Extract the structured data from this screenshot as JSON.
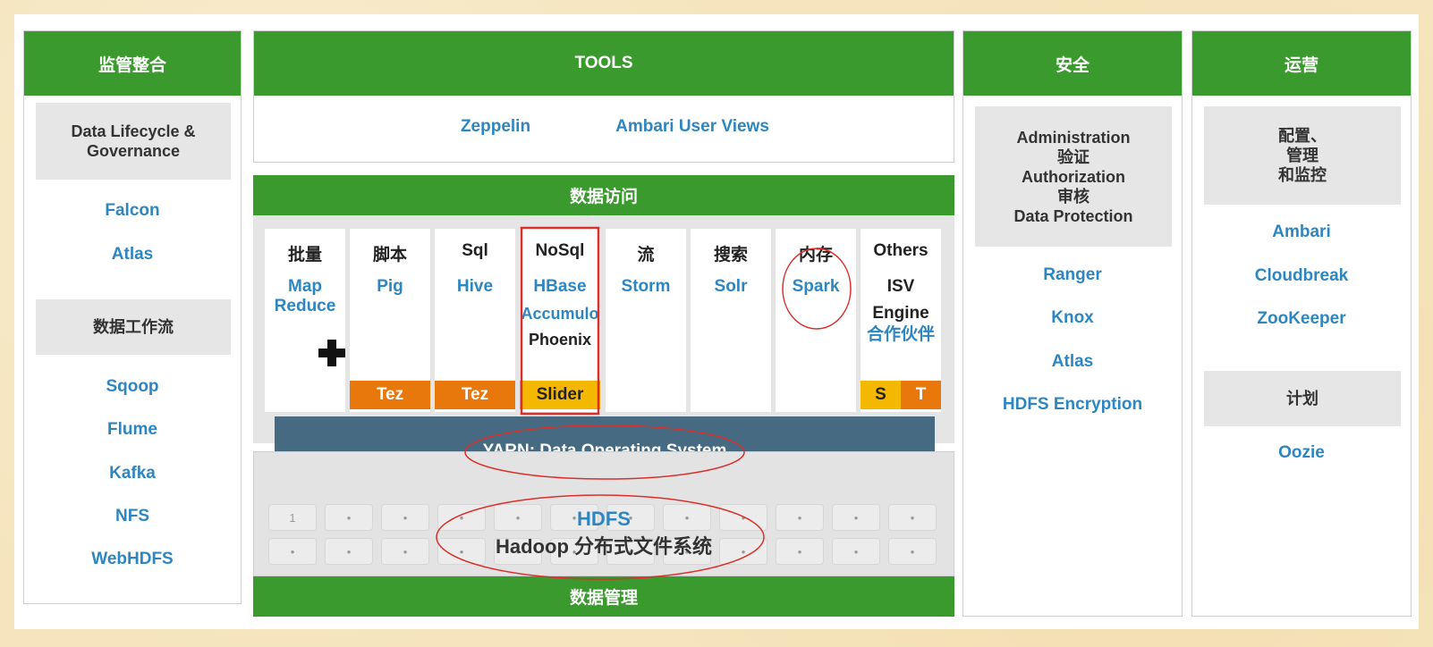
{
  "governance": {
    "header": "监管整合",
    "box1": [
      "Data Lifecycle &",
      "Governance"
    ],
    "links1": [
      "Falcon",
      "Atlas"
    ],
    "box2": "数据工作流",
    "links2": [
      "Sqoop",
      "Flume",
      "Kafka",
      "NFS",
      "WebHDFS"
    ]
  },
  "tools": {
    "header": "TOOLS",
    "items": [
      "Zeppelin",
      "Ambari User Views"
    ]
  },
  "data_access": {
    "header": "数据访问",
    "cards": [
      {
        "title": "批量",
        "lines": [
          "Map",
          "Reduce"
        ]
      },
      {
        "title": "脚本",
        "lines": [
          "Pig"
        ],
        "engine": "Tez"
      },
      {
        "title": "Sql",
        "lines": [
          "Hive"
        ],
        "engine": "Tez"
      },
      {
        "title": "NoSql",
        "lines": [
          "HBase",
          "Accumulo",
          "Phoenix"
        ],
        "engine": "Slider"
      },
      {
        "title": "流",
        "lines": [
          "Storm"
        ]
      },
      {
        "title": "搜索",
        "lines": [
          "Solr"
        ]
      },
      {
        "title": "内存",
        "lines": [
          "Spark"
        ]
      },
      {
        "title": "Others",
        "lines": [
          "ISV",
          "Engine",
          "合作伙伴"
        ],
        "engine_s": "S",
        "engine_t": "T"
      }
    ],
    "yarn": "YARN: Data Operating System"
  },
  "data_management": {
    "hdfs": "HDFS",
    "hdfs_sub": "Hadoop 分布式文件系统",
    "first_cell": "1",
    "footer": "数据管理"
  },
  "security": {
    "header": "安全",
    "box": [
      "Administration",
      "验证",
      "Authorization",
      "审核",
      "Data Protection"
    ],
    "links": [
      "Ranger",
      "Knox",
      "Atlas",
      "HDFS Encryption"
    ]
  },
  "operations": {
    "header": "运营",
    "box1": [
      "配置、",
      "管理",
      "和监控"
    ],
    "links1": [
      "Ambari",
      "Cloudbreak",
      "ZooKeeper"
    ],
    "box2": "计划",
    "links2": [
      "Oozie"
    ]
  },
  "colors": {
    "green": "#3a9a2d",
    "link_blue": "#2e86c1",
    "orange": "#e8770c",
    "yellow": "#f5b800",
    "yarn": "#456a82",
    "annotation_red": "#d9302b"
  }
}
